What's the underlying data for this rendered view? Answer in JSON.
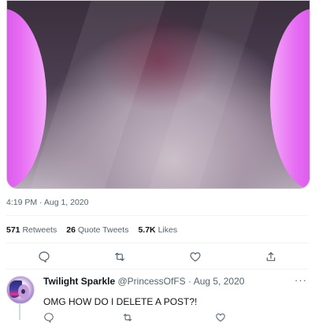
{
  "tweet": {
    "timestamp": "4:19 PM · Aug 1, 2020",
    "stats": {
      "retweets_count": "571",
      "retweets_label": "Retweets",
      "quotes_count": "26",
      "quotes_label": "Quote Tweets",
      "likes_count": "5.7K",
      "likes_label": "Likes"
    },
    "action_icons": [
      "reply-icon",
      "retweet-icon",
      "like-icon",
      "share-icon"
    ]
  },
  "reply": {
    "display_name": "Twilight Sparkle",
    "handle": "@PrincessOfFS",
    "separator": "·",
    "date": "Aug 5, 2020",
    "text": "OMG HOW DO I DELETE A POST?!",
    "more": "···"
  },
  "colors": {
    "text_primary": "#0f1419",
    "text_secondary": "#536471",
    "divider": "#eff3f4",
    "media_accent": "#e66cf3"
  }
}
